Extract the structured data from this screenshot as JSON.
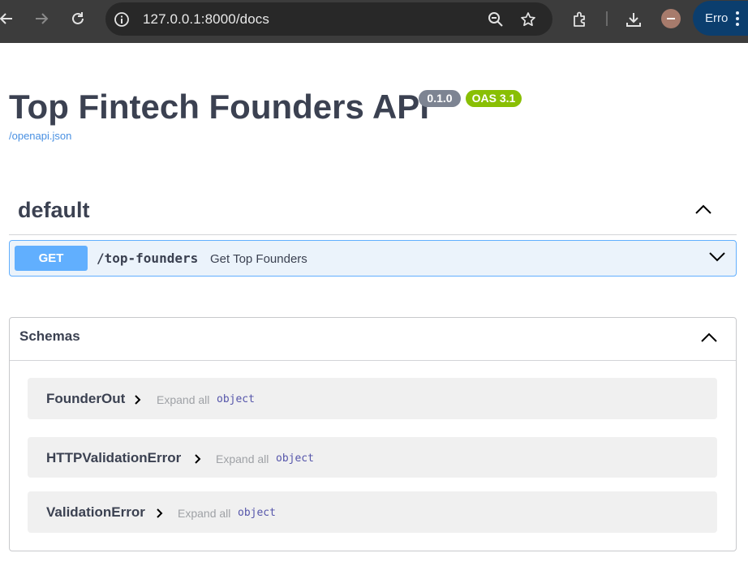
{
  "browser": {
    "url": "127.0.0.1:8000/docs",
    "profile_button_label": "Erro",
    "icons": [
      "back-icon",
      "forward-icon",
      "reload-icon",
      "site-info-icon",
      "zoom-icon",
      "bookmark-star-icon",
      "extensions-icon",
      "download-icon",
      "avatar-icon",
      "menu-icon"
    ]
  },
  "page": {
    "title": "Top Fintech Founders API",
    "version_badge": "0.1.0",
    "oas_badge": "OAS 3.1",
    "spec_link": "/openapi.json"
  },
  "tag": {
    "name": "default",
    "operations": [
      {
        "method": "GET",
        "path": "/top-founders",
        "summary": "Get Top Founders"
      }
    ]
  },
  "schemas": {
    "title": "Schemas",
    "models": [
      {
        "name": "FounderOut",
        "expand_label": "Expand all",
        "type": "object"
      },
      {
        "name": "HTTPValidationError",
        "expand_label": "Expand all",
        "type": "object"
      },
      {
        "name": "ValidationError",
        "expand_label": "Expand all",
        "type": "object"
      }
    ]
  },
  "colors": {
    "get_method": "#61affe",
    "get_block_bg": "#ebf3fb",
    "version_badge": "#7d8492",
    "oas_badge": "#89bf04",
    "link": "#4990e2",
    "text": "#3b4151"
  }
}
